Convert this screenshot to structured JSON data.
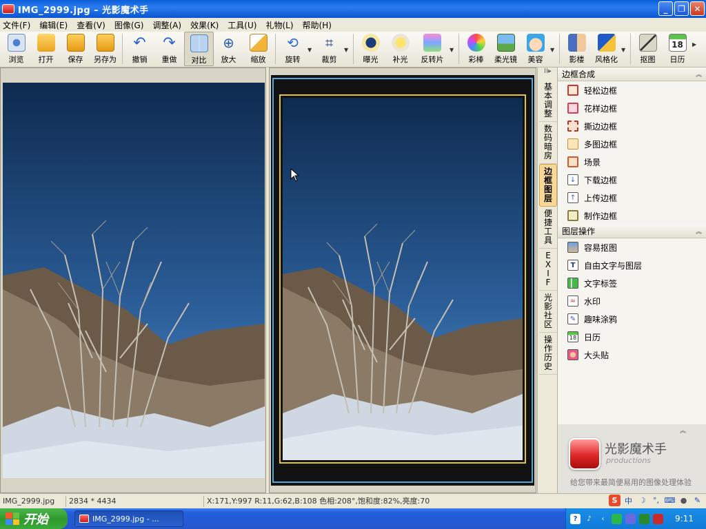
{
  "window": {
    "title": "IMG_2999.jpg  –  光影魔术手",
    "controls": {
      "minimize": "_",
      "restore": "❐",
      "close": "✕"
    }
  },
  "menu": [
    "文件(F)",
    "编辑(E)",
    "查看(V)",
    "图像(G)",
    "调整(A)",
    "效果(K)",
    "工具(U)",
    "礼物(L)",
    "帮助(H)"
  ],
  "toolbar": {
    "browse": "浏览",
    "open": "打开",
    "save": "保存",
    "save_as": "另存为",
    "undo": "撤销",
    "redo": "重做",
    "compare": "对比",
    "zoom_in": "放大",
    "zoom_fit": "缩放",
    "rotate": "旋转",
    "crop": "裁剪",
    "exposure": "曝光",
    "fill_light": "补光",
    "reversal": "反转片",
    "lomo": "彩棒",
    "soft_focus": "柔光镜",
    "beauty": "美容",
    "portrait": "影楼",
    "stylize": "风格化",
    "cutout": "抠图",
    "calendar": "日历",
    "calendar_day": "18"
  },
  "side_tabs": {
    "toggle": "II▸",
    "basic": "基\n本\n调\n整",
    "darkroom": "数\n码\n暗\n房",
    "frames": "边\n框\n图\n层",
    "tools": "便\n捷\n工\n具",
    "exif": "E\nX\nI\nF",
    "community": "光\n影\n社\n区",
    "history": "操\n作\n历\n史"
  },
  "frame_panel": {
    "title": "边框合成",
    "items": [
      "轻松边框",
      "花样边框",
      "撕边边框",
      "多图边框",
      "场景",
      "下载边框",
      "上传边框",
      "制作边框"
    ]
  },
  "layer_panel": {
    "title": "图层操作",
    "items": [
      "容易抠图",
      "自由文字与图层",
      "文字标签",
      "水印",
      "趣味涂鸦",
      "日历",
      "大头贴"
    ]
  },
  "promo": {
    "title": "光影魔术手",
    "subtitle": "productions",
    "slogan": "给您带来最简便易用的图像处理体验"
  },
  "status": {
    "filename": "IMG_2999.jpg",
    "dimensions": "2834 * 4434",
    "pixel_info": "X:171,Y:997 R:11,G:62,B:108 色相:208°,饱和度:82%,亮度:70"
  },
  "ime": {
    "sogou": "S",
    "lang": "中",
    "moon": "☽",
    "punct": "°,"
  },
  "taskbar": {
    "start": "开始",
    "task": "IMG_2999.jpg - ...",
    "clock": "9:11"
  },
  "colors": {
    "sky_top": "#0e2a4e",
    "sky_bottom": "#3f7ab8",
    "frame_outer": "#121212",
    "frame_gold": "#e2c33a",
    "frame_blue_line": "#5aa6de",
    "accent_tab": "#f7d79a"
  }
}
